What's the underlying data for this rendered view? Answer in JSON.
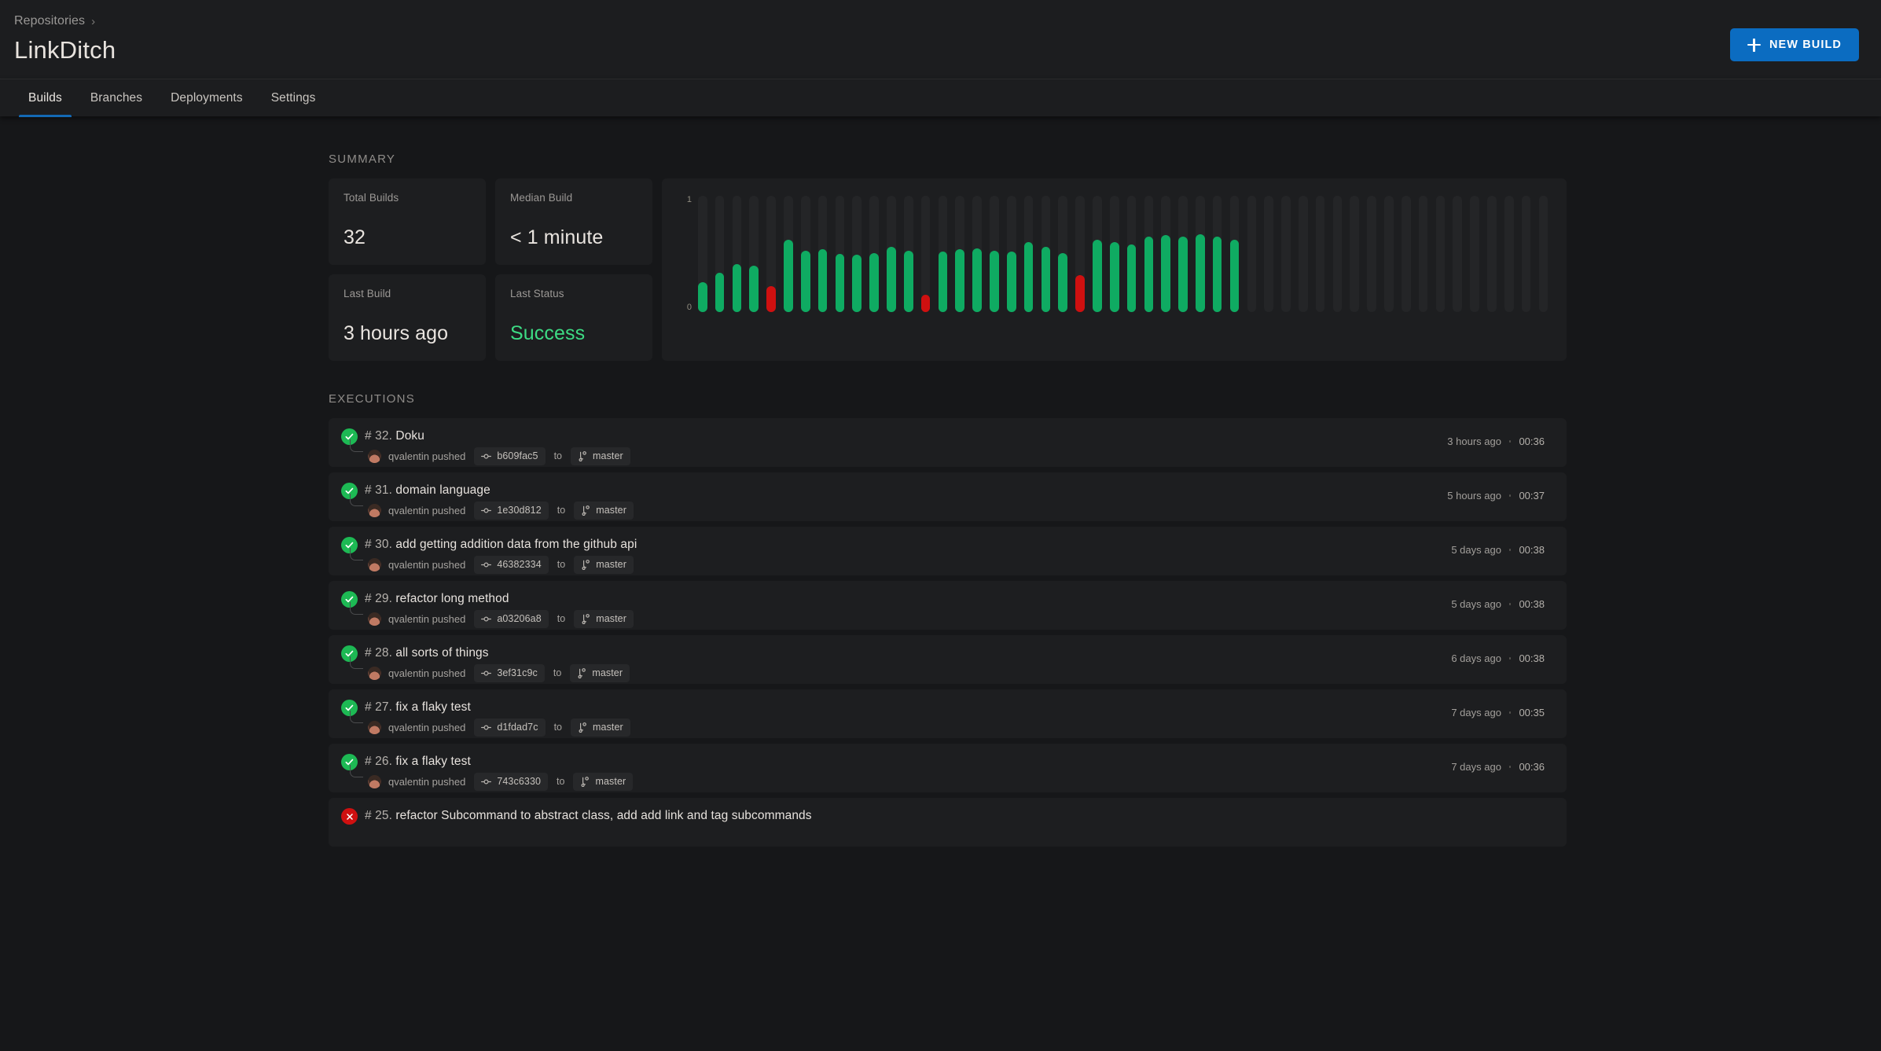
{
  "header": {
    "breadcrumb": "Repositories",
    "breadcrumb_separator": "›",
    "title": "LinkDitch",
    "new_build_label": "NEW BUILD",
    "accent_color": "#0b6cc1"
  },
  "tabs": [
    {
      "label": "Builds",
      "active": true
    },
    {
      "label": "Branches",
      "active": false
    },
    {
      "label": "Deployments",
      "active": false
    },
    {
      "label": "Settings",
      "active": false
    }
  ],
  "summary": {
    "label": "SUMMARY",
    "stats": [
      {
        "label": "Total Builds",
        "value": "32",
        "kind": "plain"
      },
      {
        "label": "Median Build",
        "value": "< 1 minute",
        "kind": "plain"
      },
      {
        "label": "Last Build",
        "value": "3 hours ago",
        "kind": "plain"
      },
      {
        "label": "Last Status",
        "value": "Success",
        "kind": "success"
      }
    ]
  },
  "chart_data": {
    "type": "bar",
    "title": "",
    "xlabel": "",
    "ylabel": "",
    "ylim": [
      0,
      1
    ],
    "ytick_labels": [
      "0",
      "1"
    ],
    "grid": false,
    "legend": "none",
    "slots": 50,
    "success_color": "#0fab62",
    "failure_color": "#cf1010",
    "track_color": "#242527",
    "values": [
      0.26,
      0.34,
      0.41,
      0.4,
      0.22,
      0.62,
      0.53,
      0.54,
      0.5,
      0.49,
      0.51,
      0.56,
      0.53,
      0.15,
      0.52,
      0.54,
      0.55,
      0.53,
      0.52,
      0.6,
      0.56,
      0.51,
      0.32,
      0.62,
      0.6,
      0.58,
      0.65,
      0.66,
      0.65,
      0.67,
      0.65,
      0.62
    ],
    "statuses": [
      "success",
      "success",
      "success",
      "success",
      "failure",
      "success",
      "success",
      "success",
      "success",
      "success",
      "success",
      "success",
      "success",
      "failure",
      "success",
      "success",
      "success",
      "success",
      "success",
      "success",
      "success",
      "success",
      "failure",
      "success",
      "success",
      "success",
      "success",
      "success",
      "success",
      "success",
      "success",
      "success"
    ]
  },
  "executions": {
    "label": "EXECUTIONS",
    "rows": [
      {
        "status": "success",
        "number": "# 32.",
        "title": "Doku",
        "author": "qvalentin",
        "action": "pushed",
        "commit": "b609fac5",
        "to": "to",
        "branch": "master",
        "time": "3 hours ago",
        "duration": "00:36"
      },
      {
        "status": "success",
        "number": "# 31.",
        "title": "domain language",
        "author": "qvalentin",
        "action": "pushed",
        "commit": "1e30d812",
        "to": "to",
        "branch": "master",
        "time": "5 hours ago",
        "duration": "00:37"
      },
      {
        "status": "success",
        "number": "# 30.",
        "title": "add getting addition data from the github api",
        "author": "qvalentin",
        "action": "pushed",
        "commit": "46382334",
        "to": "to",
        "branch": "master",
        "time": "5 days ago",
        "duration": "00:38"
      },
      {
        "status": "success",
        "number": "# 29.",
        "title": "refactor long method",
        "author": "qvalentin",
        "action": "pushed",
        "commit": "a03206a8",
        "to": "to",
        "branch": "master",
        "time": "5 days ago",
        "duration": "00:38"
      },
      {
        "status": "success",
        "number": "# 28.",
        "title": "all sorts of things",
        "author": "qvalentin",
        "action": "pushed",
        "commit": "3ef31c9c",
        "to": "to",
        "branch": "master",
        "time": "6 days ago",
        "duration": "00:38"
      },
      {
        "status": "success",
        "number": "# 27.",
        "title": "fix a flaky test",
        "author": "qvalentin",
        "action": "pushed",
        "commit": "d1fdad7c",
        "to": "to",
        "branch": "master",
        "time": "7 days ago",
        "duration": "00:35"
      },
      {
        "status": "success",
        "number": "# 26.",
        "title": "fix a flaky test",
        "author": "qvalentin",
        "action": "pushed",
        "commit": "743c6330",
        "to": "to",
        "branch": "master",
        "time": "7 days ago",
        "duration": "00:36"
      },
      {
        "status": "failure",
        "number": "# 25.",
        "title": "refactor Subcommand to abstract class, add add link and tag subcommands",
        "author": "",
        "action": "",
        "commit": "",
        "to": "",
        "branch": "",
        "time": "",
        "duration": ""
      }
    ]
  }
}
